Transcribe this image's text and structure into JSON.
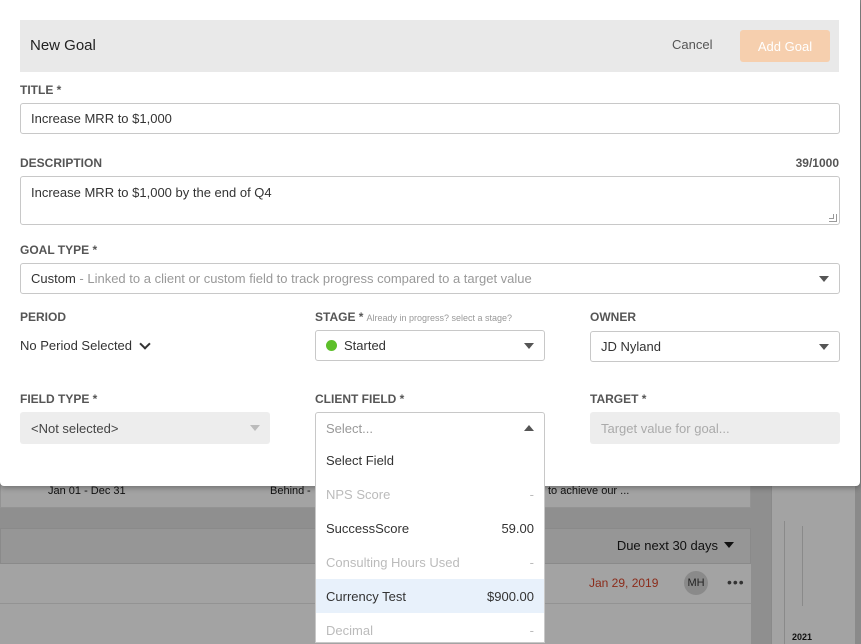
{
  "background": {
    "period_range": "Jan 01 - Dec 31",
    "status": "Behind",
    "snippet": "to achieve our ...",
    "filter_label": "Due next 30 days",
    "task_date": "Jan 29, 2019",
    "avatar_initials": "MH",
    "more_dots": "•••",
    "year_label": "2021"
  },
  "modal": {
    "title": "New Goal",
    "cancel_label": "Cancel",
    "add_label": "Add Goal",
    "title_field": {
      "label": "TITLE *",
      "value": "Increase MRR to $1,000"
    },
    "description_field": {
      "label": "DESCRIPTION",
      "counter": "39/1000",
      "value": "Increase MRR to $1,000 by the end of Q4"
    },
    "goal_type": {
      "label": "GOAL TYPE *",
      "value": "Custom",
      "description": " - Linked to a client or custom field to track progress compared to a target value"
    },
    "period": {
      "label": "PERIOD",
      "value": "No Period Selected"
    },
    "stage": {
      "label": "STAGE *",
      "hint": "Already in progress? select a stage?",
      "value": "Started",
      "dot_color": "#5dbf2a"
    },
    "owner": {
      "label": "OWNER",
      "value": "JD Nyland"
    },
    "field_type": {
      "label": "FIELD TYPE *",
      "value": "<Not selected>"
    },
    "client_field": {
      "label": "CLIENT FIELD *",
      "placeholder": "Select...",
      "options": [
        {
          "label": "Select Field",
          "value": "",
          "state": "normal"
        },
        {
          "label": "NPS Score",
          "value": "-",
          "state": "disabled"
        },
        {
          "label": "SuccessScore",
          "value": "59.00",
          "state": "normal"
        },
        {
          "label": "Consulting Hours Used",
          "value": "-",
          "state": "disabled"
        },
        {
          "label": "Currency Test",
          "value": "$900.00",
          "state": "active"
        },
        {
          "label": "Decimal",
          "value": "-",
          "state": "disabled"
        }
      ]
    },
    "target": {
      "label": "TARGET *",
      "placeholder": "Target value for goal..."
    }
  },
  "colors": {
    "accent": "#f6cfae",
    "highlight": "#e8f1fb",
    "overdue": "#8b2b1a"
  }
}
